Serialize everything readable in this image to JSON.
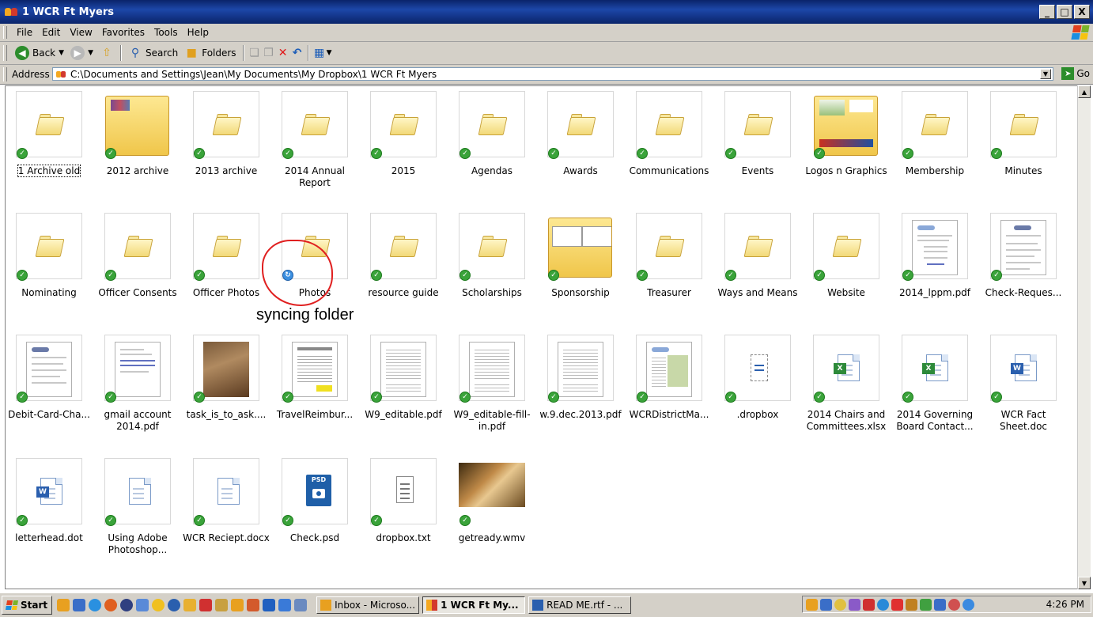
{
  "window": {
    "title": "1 WCR Ft Myers",
    "controls": [
      "_",
      "□",
      "X"
    ]
  },
  "menu": [
    "File",
    "Edit",
    "View",
    "Favorites",
    "Tools",
    "Help"
  ],
  "toolbar": {
    "back": "Back",
    "search": "Search",
    "folders": "Folders"
  },
  "address": {
    "label": "Address",
    "path": "C:\\Documents and Settings\\Jean\\My Documents\\My Dropbox\\1 WCR Ft Myers",
    "go": "Go"
  },
  "items": [
    {
      "name": "1 Archive old",
      "type": "folder",
      "status": "synced",
      "selected": true
    },
    {
      "name": "2012 archive",
      "type": "folder-photo",
      "status": "synced"
    },
    {
      "name": "2013 archive",
      "type": "folder",
      "status": "synced"
    },
    {
      "name": "2014 Annual Report",
      "type": "folder",
      "status": "synced"
    },
    {
      "name": "2015",
      "type": "folder",
      "status": "synced"
    },
    {
      "name": "Agendas",
      "type": "folder",
      "status": "synced"
    },
    {
      "name": "Awards",
      "type": "folder",
      "status": "synced"
    },
    {
      "name": "Communications",
      "type": "folder",
      "status": "synced"
    },
    {
      "name": "Events",
      "type": "folder",
      "status": "synced"
    },
    {
      "name": "Logos n Graphics",
      "type": "folder-photo",
      "status": "synced"
    },
    {
      "name": "Membership",
      "type": "folder",
      "status": "synced"
    },
    {
      "name": "Minutes",
      "type": "folder",
      "status": "synced"
    },
    {
      "name": "Nominating",
      "type": "folder",
      "status": "synced"
    },
    {
      "name": "Officer Consents",
      "type": "folder",
      "status": "synced"
    },
    {
      "name": "Officer Photos",
      "type": "folder",
      "status": "synced"
    },
    {
      "name": "Photos",
      "type": "folder",
      "status": "syncing"
    },
    {
      "name": "resource guide",
      "type": "folder",
      "status": "synced"
    },
    {
      "name": "Scholarships",
      "type": "folder",
      "status": "synced"
    },
    {
      "name": "Sponsorship",
      "type": "folder-photo",
      "status": "synced"
    },
    {
      "name": "Treasurer",
      "type": "folder",
      "status": "synced"
    },
    {
      "name": "Ways and Means",
      "type": "folder",
      "status": "synced"
    },
    {
      "name": "Website",
      "type": "folder",
      "status": "synced"
    },
    {
      "name": "2014_lppm.pdf",
      "type": "doc",
      "status": "synced"
    },
    {
      "name": "Check-Reques...",
      "type": "doc",
      "status": "synced"
    },
    {
      "name": "Debit-Card-Cha...",
      "type": "doc",
      "status": "synced"
    },
    {
      "name": "gmail account 2014.pdf",
      "type": "doc",
      "status": "synced"
    },
    {
      "name": "task_is_to_ask....",
      "type": "image",
      "status": "synced"
    },
    {
      "name": "TravelReimbur...",
      "type": "doc",
      "status": "synced"
    },
    {
      "name": "W9_editable.pdf",
      "type": "doc",
      "status": "synced"
    },
    {
      "name": "W9_editable-fill-in.pdf",
      "type": "doc",
      "status": "synced"
    },
    {
      "name": "w.9.dec.2013.pdf",
      "type": "doc",
      "status": "synced"
    },
    {
      "name": "WCRDistrictMa...",
      "type": "doc",
      "status": "synced"
    },
    {
      "name": ".dropbox",
      "type": "sys",
      "status": "synced"
    },
    {
      "name": "2014 Chairs and Committees.xlsx",
      "type": "xlsx",
      "status": "synced"
    },
    {
      "name": "2014 Governing Board Contact...",
      "type": "xlsx",
      "status": "synced"
    },
    {
      "name": "WCR Fact Sheet.doc",
      "type": "word",
      "status": "synced"
    },
    {
      "name": "letterhead.dot",
      "type": "word",
      "status": "synced"
    },
    {
      "name": "Using Adobe Photoshop...",
      "type": "docx",
      "status": "synced"
    },
    {
      "name": "WCR Reciept.docx",
      "type": "docx",
      "status": "synced"
    },
    {
      "name": "Check.psd",
      "type": "psd",
      "status": "synced"
    },
    {
      "name": "dropbox.txt",
      "type": "txt",
      "status": "synced"
    },
    {
      "name": "getready.wmv",
      "type": "video",
      "status": "synced"
    }
  ],
  "annotation": {
    "text": "syncing folder"
  },
  "taskbar": {
    "start": "Start",
    "tasks": [
      {
        "label": "Inbox - Microso...",
        "active": false
      },
      {
        "label": "1 WCR Ft My...",
        "active": true
      },
      {
        "label": "READ ME.rtf - ...",
        "active": false
      }
    ],
    "clock": "4:26 PM"
  },
  "colors": {
    "titlebar": "#0a246a",
    "chrome": "#d4d0c8",
    "sync_ok": "#3aa33a",
    "syncing": "#3b8fe0",
    "annotation": "#e02020"
  }
}
